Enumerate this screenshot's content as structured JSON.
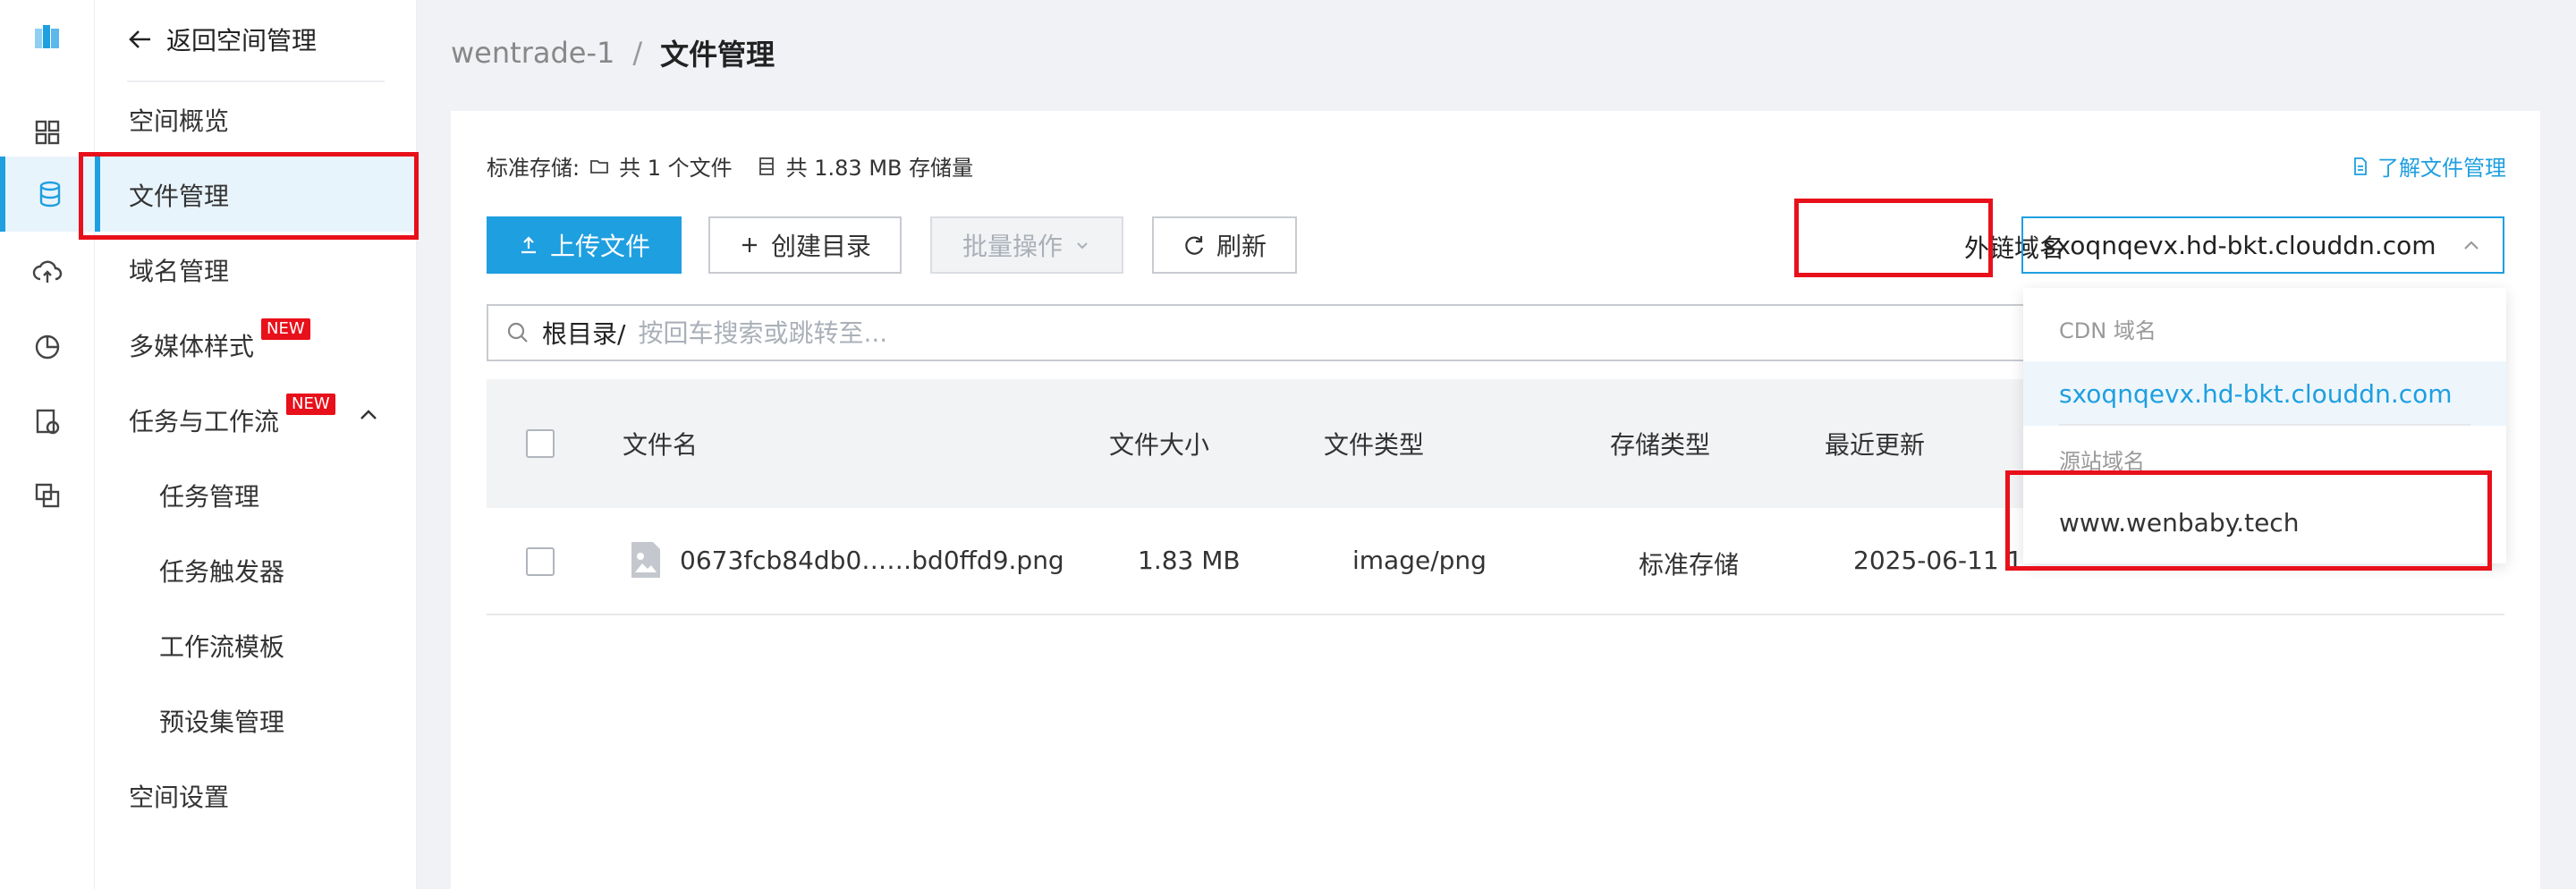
{
  "rail": {
    "icons": [
      "logo-icon",
      "dashboard-icon",
      "storage-icon",
      "cloud-upload-icon",
      "analytics-icon",
      "certificate-icon",
      "transfer-icon"
    ]
  },
  "menu": {
    "back_label": "返回空间管理",
    "items": [
      {
        "label": "空间概览"
      },
      {
        "label": "文件管理"
      },
      {
        "label": "域名管理"
      },
      {
        "label": "多媒体样式",
        "badge": "NEW"
      },
      {
        "label": "任务与工作流",
        "badge": "NEW"
      },
      {
        "label": "任务管理"
      },
      {
        "label": "任务触发器"
      },
      {
        "label": "工作流模板"
      },
      {
        "label": "预设集管理"
      },
      {
        "label": "空间设置"
      }
    ]
  },
  "breadcrumb": {
    "bucket": "wentrade-1",
    "separator": "/",
    "page": "文件管理"
  },
  "stats": {
    "prefix": "标准存储:",
    "files": "共 1 个文件",
    "storage": "共 1.83 MB 存储量"
  },
  "learn_link": "了解文件管理",
  "toolbar": {
    "upload": "上传文件",
    "create_dir": "创建目录",
    "batch": "批量操作",
    "refresh": "刷新"
  },
  "domain": {
    "label": "外链域名",
    "selected": "sxoqnqevx.hd-bkt.clouddn.com",
    "dropdown": {
      "cdn_group": "CDN 域名",
      "cdn_option": "sxoqnqevx.hd-bkt.clouddn.com",
      "origin_group": "源站域名",
      "origin_option": "www.wenbaby.tech"
    }
  },
  "search": {
    "root": "根目录/",
    "placeholder": "按回车搜索或跳转至..."
  },
  "table": {
    "headers": {
      "name": "文件名",
      "size": "文件大小",
      "type": "文件类型",
      "storage": "存储类型",
      "updated": "最近更新"
    },
    "rows": [
      {
        "name": "0673fcb84db0……bd0ffd9.png",
        "size": "1.83 MB",
        "type": "image/png",
        "storage": "标准存储",
        "updated": "2025-06-11 1"
      }
    ]
  },
  "colors": {
    "accent": "#1e9fe0",
    "highlight_box": "#e8101a"
  }
}
